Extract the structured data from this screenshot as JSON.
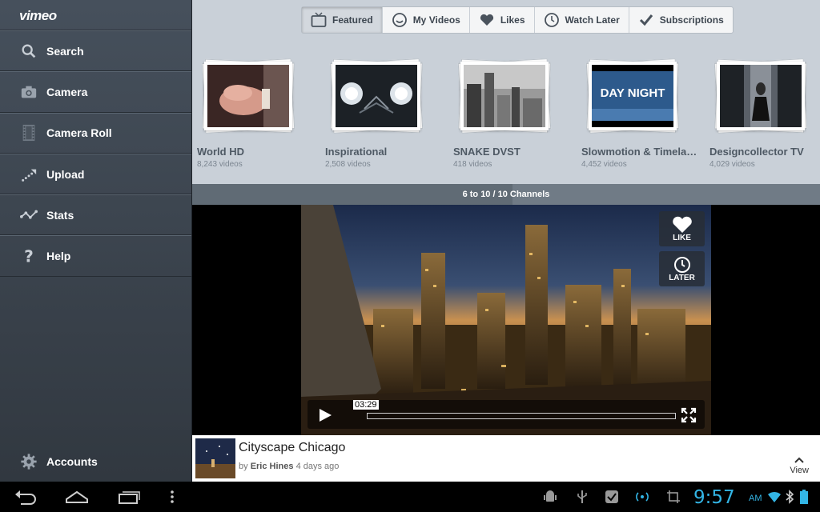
{
  "sidebar": {
    "logo": "vimeo",
    "items": [
      {
        "label": "Search",
        "icon": "search-icon"
      },
      {
        "label": "Camera",
        "icon": "camera-icon"
      },
      {
        "label": "Camera Roll",
        "icon": "film-strip-icon"
      },
      {
        "label": "Upload",
        "icon": "upload-icon"
      },
      {
        "label": "Stats",
        "icon": "stats-icon"
      },
      {
        "label": "Help",
        "icon": "help-icon"
      }
    ],
    "accounts_label": "Accounts"
  },
  "tabs": [
    {
      "label": "Featured",
      "icon": "tv-icon",
      "active": true
    },
    {
      "label": "My Videos",
      "icon": "smiley-icon",
      "active": false
    },
    {
      "label": "Likes",
      "icon": "heart-icon",
      "active": false
    },
    {
      "label": "Watch Later",
      "icon": "clock-icon",
      "active": false
    },
    {
      "label": "Subscriptions",
      "icon": "checkmark-icon",
      "active": false
    }
  ],
  "channels": [
    {
      "name": "World HD",
      "count": "8,243 videos"
    },
    {
      "name": "Inspirational",
      "count": "2,508 videos"
    },
    {
      "name": "SNAKE DVST",
      "count": "418 videos"
    },
    {
      "name": "Slowmotion & Timelaps…",
      "count": "4,452 videos"
    },
    {
      "name": "Designcollector TV",
      "count": "4,029 videos"
    }
  ],
  "channel_thumb_texts": {
    "day_night": "DAY NIGHT"
  },
  "pager": {
    "label": "6 to 10 / 10 Channels",
    "progress_fraction": 0.51
  },
  "player": {
    "like_label": "LIKE",
    "later_label": "LATER",
    "time": "03:29"
  },
  "video_info": {
    "title": "Cityscape Chicago",
    "by_prefix": "by",
    "author": "Eric Hines",
    "age": "4 days ago",
    "view_label": "View"
  },
  "statusbar": {
    "time": "9:57",
    "ampm": "AM"
  },
  "colors": {
    "accent_clock": "#33b5e5",
    "sidebar_bg": "#3d4650"
  }
}
